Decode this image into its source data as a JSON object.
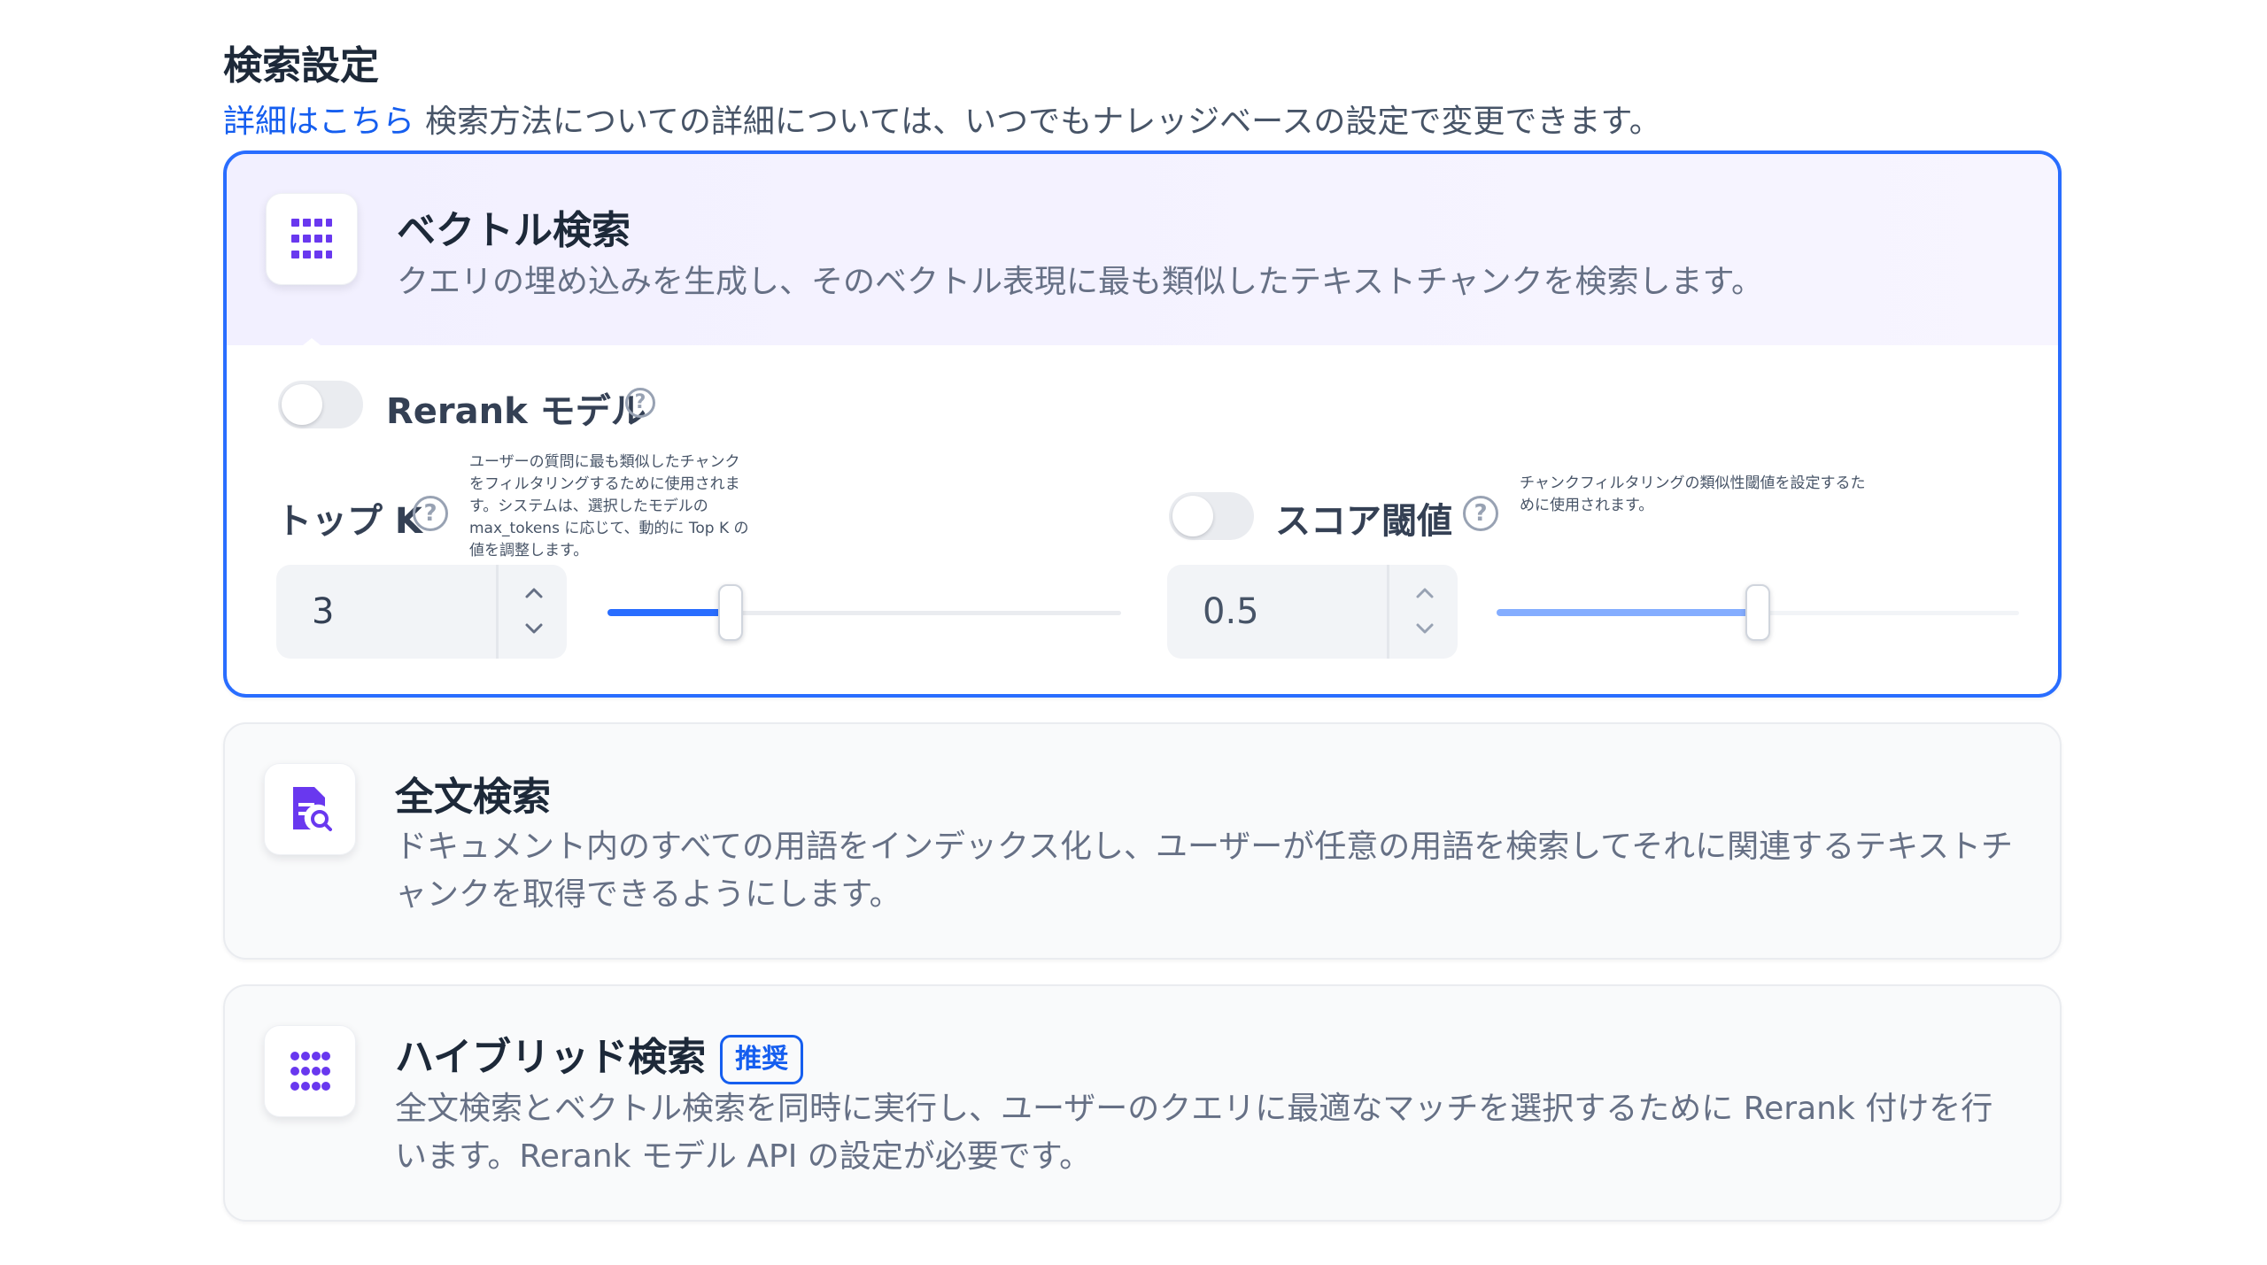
{
  "section": {
    "title": "検索設定",
    "learn_more": "詳細はこちら",
    "subtitle": "検索方法についての詳細については、いつでもナレッジベースの設定で変更できます。"
  },
  "vector": {
    "title": "ベクトル検索",
    "desc": "クエリの埋め込みを生成し、そのベクトル表現に最も類似したテキストチャンクを検索します。",
    "icon": "grid-dots-icon",
    "rerank_label": "Rerank モデル",
    "rerank_enabled": false,
    "topk": {
      "label": "トップ K",
      "tooltip": "ユーザーの質問に最も類似したチャンクをフィルタリングするために使用されます。システムは、選択したモデルの max_tokens に応じて、動的に Top K の値を調整します。",
      "value": "3",
      "slider_fraction": 0.24
    },
    "score": {
      "label": "スコア閾値",
      "tooltip": "チャンクフィルタリングの類似性閾値を設定するために使用されます。",
      "enabled": false,
      "value": "0.5",
      "slider_fraction": 0.5
    }
  },
  "fulltext": {
    "title": "全文検索",
    "desc": "ドキュメント内のすべての用語をインデックス化し、ユーザーが任意の用語を検索してそれに関連するテキストチャンクを取得できるようにします。",
    "icon": "document-search-icon"
  },
  "hybrid": {
    "title": "ハイブリッド検索",
    "badge": "推奨",
    "desc": "全文検索とベクトル検索を同時に実行し、ユーザーのクエリに最適なマッチを選択するために Rerank 付けを行います。Rerank モデル API の設定が必要です。",
    "icon": "grid-dots-icon"
  },
  "colors": {
    "accent": "#296dff",
    "icon_purple": "#6938ef",
    "slider_fill_active": "#296dff",
    "slider_fill_disabled": "#84adff"
  }
}
